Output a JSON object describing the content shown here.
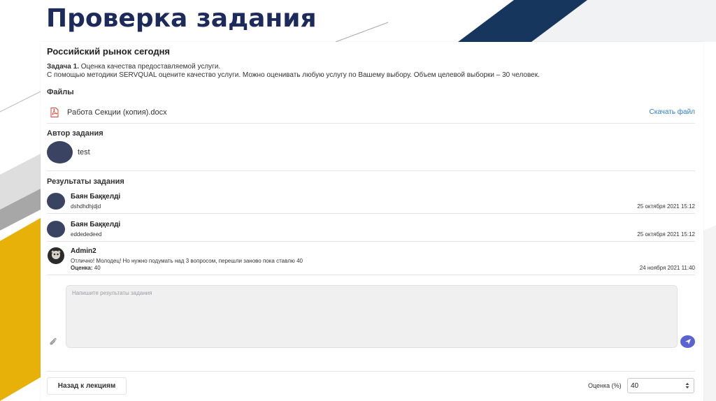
{
  "slide": {
    "title": "Проверка задания",
    "colors": {
      "title": "#1d2a5c",
      "navy_stripe": "#17365d",
      "yellow_stripe": "#e8b10a"
    }
  },
  "assignment": {
    "course_title": "Российский рынок сегодня",
    "task_label": "Задача 1.",
    "task_title": " Оценка качества предоставляемой услуги.",
    "task_description": "С помощью методики SERVQUAL оцените качество услуги. Можно оценивать любую услугу по Вашему выбору. Объем целевой выборки – 30 человек."
  },
  "files": {
    "label": "Файлы",
    "items": [
      {
        "name": "Работа Секции (копия).docx",
        "icon": "pdf-icon",
        "action_label": "Скачать файл"
      }
    ]
  },
  "author": {
    "label": "Автор задания",
    "name": "test"
  },
  "results": {
    "label": "Результаты задания",
    "items": [
      {
        "name": "Баян Баққелді",
        "text": "dshdhdhjdjd",
        "date": "25 октября 2021 15:12"
      },
      {
        "name": "Баян Баққелді",
        "text": "eddededeed",
        "date": "25 октября 2021 15:12"
      },
      {
        "name": "Admin2",
        "text": "Отлично! Молодец! Но нужно подумать над 3 вопросом, перешли заново пока ставлю 40",
        "grade_label": "Оценка:",
        "grade_value": " 40",
        "date": "24 ноября 2021 11:40"
      }
    ]
  },
  "comment": {
    "placeholder": "Напишите результаты задания",
    "value": ""
  },
  "footer": {
    "back_label": "Назад к лекциям",
    "grade_label": "Оценка (%)",
    "grade_value": "40"
  },
  "colors": {
    "accent": "#5b63d3",
    "link": "#2f80d1",
    "avatar": "#3b4363"
  }
}
